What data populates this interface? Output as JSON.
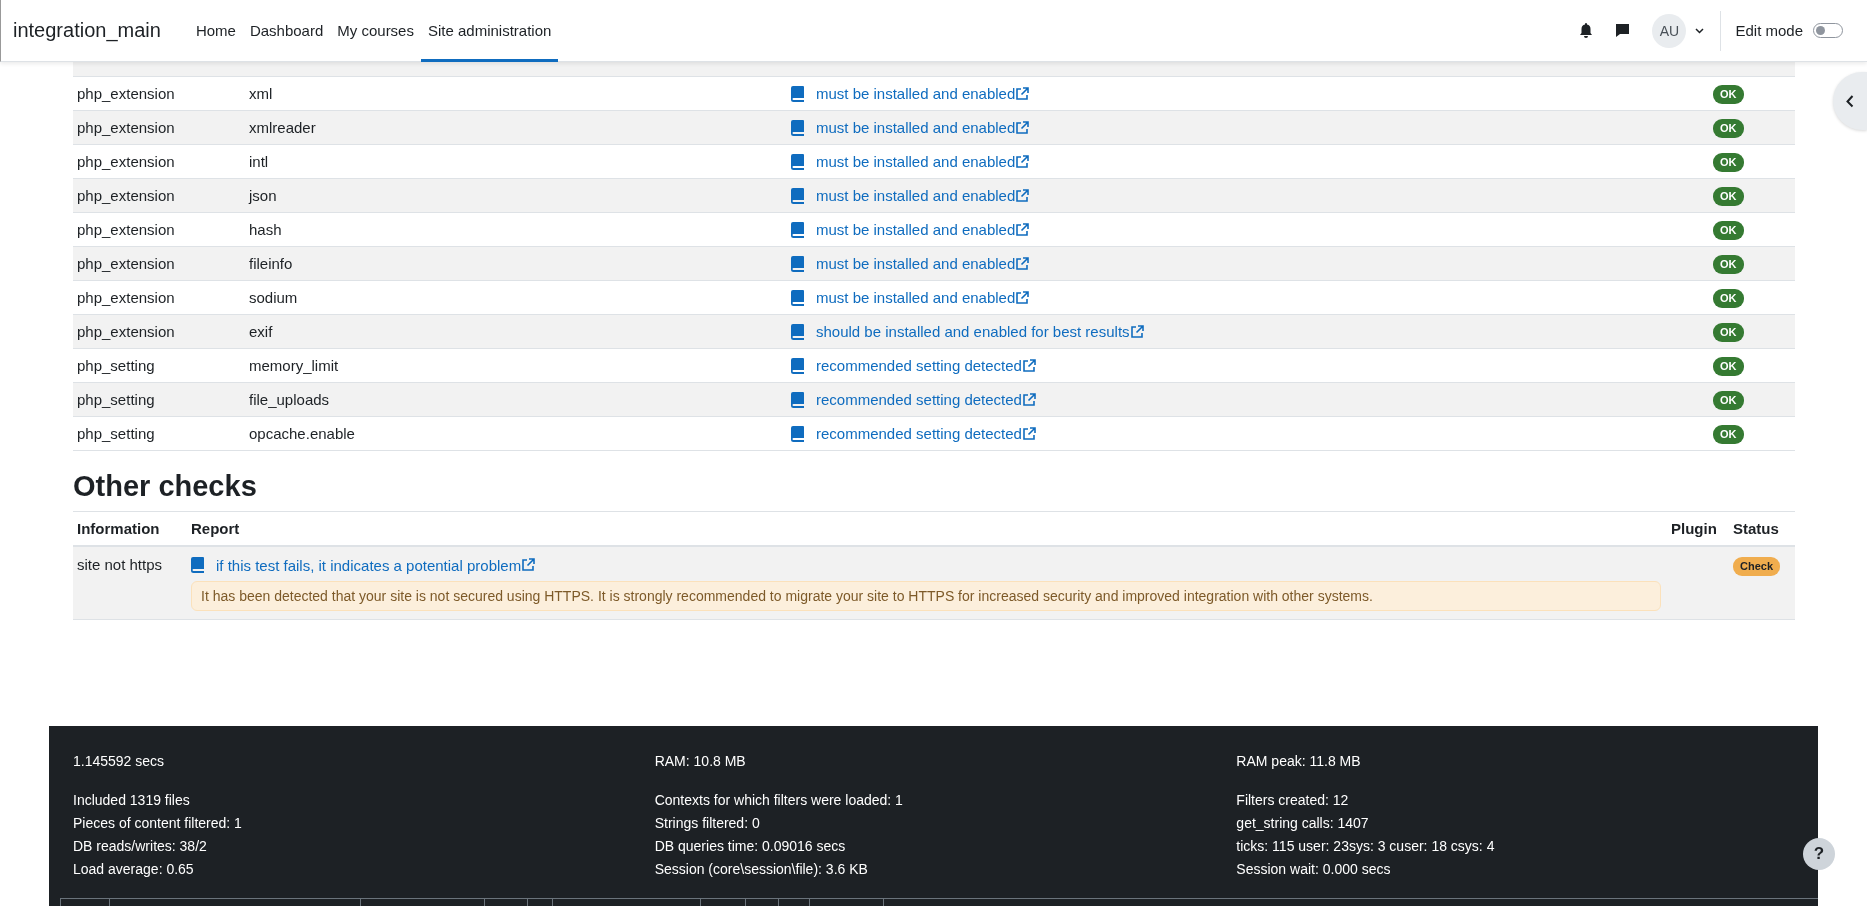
{
  "navbar": {
    "site_name": "integration_main",
    "nav_items": [
      {
        "label": "Home",
        "selected": false
      },
      {
        "label": "Dashboard",
        "selected": false
      },
      {
        "label": "My courses",
        "selected": false
      },
      {
        "label": "Site administration",
        "selected": true
      }
    ],
    "avatar": "AU",
    "edit_mode": {
      "label": "Edit mode",
      "on": false
    }
  },
  "environment_table": {
    "rows": [
      {
        "type": "php_extension",
        "name": "xml",
        "report": "must be installed and enabled",
        "status": "OK",
        "color": "#357a32"
      },
      {
        "type": "php_extension",
        "name": "xmlreader",
        "report": "must be installed and enabled",
        "status": "OK",
        "color": "#357a32"
      },
      {
        "type": "php_extension",
        "name": "intl",
        "report": "must be installed and enabled",
        "status": "OK",
        "color": "#357a32"
      },
      {
        "type": "php_extension",
        "name": "json",
        "report": "must be installed and enabled",
        "status": "OK",
        "color": "#357a32"
      },
      {
        "type": "php_extension",
        "name": "hash",
        "report": "must be installed and enabled",
        "status": "OK",
        "color": "#357a32"
      },
      {
        "type": "php_extension",
        "name": "fileinfo",
        "report": "must be installed and enabled",
        "status": "OK",
        "color": "#357a32"
      },
      {
        "type": "php_extension",
        "name": "sodium",
        "report": "must be installed and enabled",
        "status": "OK",
        "color": "#357a32"
      },
      {
        "type": "php_extension",
        "name": "exif",
        "report": "should be installed and enabled for best results",
        "status": "OK",
        "color": "#357a32"
      },
      {
        "type": "php_setting",
        "name": "memory_limit",
        "report": "recommended setting detected",
        "status": "OK",
        "color": "#357a32"
      },
      {
        "type": "php_setting",
        "name": "file_uploads",
        "report": "recommended setting detected",
        "status": "OK",
        "color": "#357a32"
      },
      {
        "type": "php_setting",
        "name": "opcache.enable",
        "report": "recommended setting detected",
        "status": "OK",
        "color": "#357a32"
      }
    ]
  },
  "other_checks": {
    "title": "Other checks",
    "columns": [
      "Information",
      "Report",
      "Plugin",
      "Status"
    ],
    "rows": [
      {
        "information": "site not https",
        "report": "if this test fails, it indicates a potential problem",
        "alert": "It has been detected that your site is not secured using HTTPS. It is strongly recommended to migrate your site to HTTPS for increased security and improved integration with other systems.",
        "status": "Check",
        "color": "#f0ad4e"
      }
    ]
  },
  "performance_footer": {
    "columns": [
      {
        "headline": "1.145592 secs",
        "lines": [
          "Included 1319 files",
          "Pieces of content filtered: 1",
          "DB reads/writes: 38/2",
          "Load average: 0.65"
        ]
      },
      {
        "headline": "RAM: 10.8 MB",
        "lines": [
          "Contexts for which filters were loaded: 1",
          "Strings filtered: 0",
          "DB queries time: 0.09016 secs",
          "Session (core\\session\\file): 3.6 KB"
        ]
      },
      {
        "headline": "RAM peak: 11.8 MB",
        "lines": [
          "Filters created: 12",
          "get_string calls: 1407",
          "ticks: 115 user: 23sys: 3 cuser: 18 csys: 4",
          "Session wait: 0.000 secs"
        ]
      }
    ]
  },
  "help_button": "?"
}
